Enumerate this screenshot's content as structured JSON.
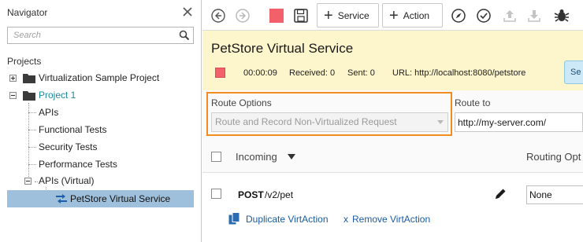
{
  "navigator": {
    "title": "Navigator",
    "search_placeholder": "Search",
    "projects_label": "Projects",
    "tree": {
      "virtualization_sample_project": "Virtualization Sample Project",
      "project_1": "Project 1",
      "apis": "APIs",
      "functional_tests": "Functional Tests",
      "security_tests": "Security Tests",
      "performance_tests": "Performance Tests",
      "apis_virtual": "APIs (Virtual)",
      "petstore_virtual_service": "PetStore Virtual Service"
    }
  },
  "toolbar": {
    "service_label": "Service",
    "action_label": "Action",
    "icons": [
      "back-icon",
      "forward-icon",
      "stop-icon",
      "save-icon",
      "add-service-icon",
      "add-action-icon",
      "compass-icon",
      "checkmark-icon",
      "upload-icon",
      "download-icon",
      "bug-icon"
    ]
  },
  "service": {
    "title": "PetStore Virtual Service",
    "time": "00:00:09",
    "received": "Received: 0",
    "sent": "Sent: 0",
    "url": "URL: http://localhost:8080/petstore",
    "button_cut": "Se"
  },
  "routing": {
    "route_options_label": "Route Options",
    "route_options_value": "Route and Record Non-Virtualized Request",
    "route_to_label": "Route to",
    "route_to_value": "http://my-server.com/"
  },
  "table": {
    "incoming_header": "Incoming",
    "routing_header": "Routing Opt",
    "rows": [
      {
        "method": "POST",
        "path": "/v2/pet",
        "routing_value": "None",
        "duplicate_label": "Duplicate VirtAction",
        "remove_x": "x",
        "remove_label": "Remove VirtAction"
      }
    ]
  },
  "colors": {
    "accent_orange": "#f28c1e",
    "header_yellow": "#fdf5cc",
    "stop_red": "#f2606a",
    "selection_blue": "#9fc0dc",
    "project_teal": "#1a8aa0",
    "link_blue": "#1a5a9e"
  }
}
